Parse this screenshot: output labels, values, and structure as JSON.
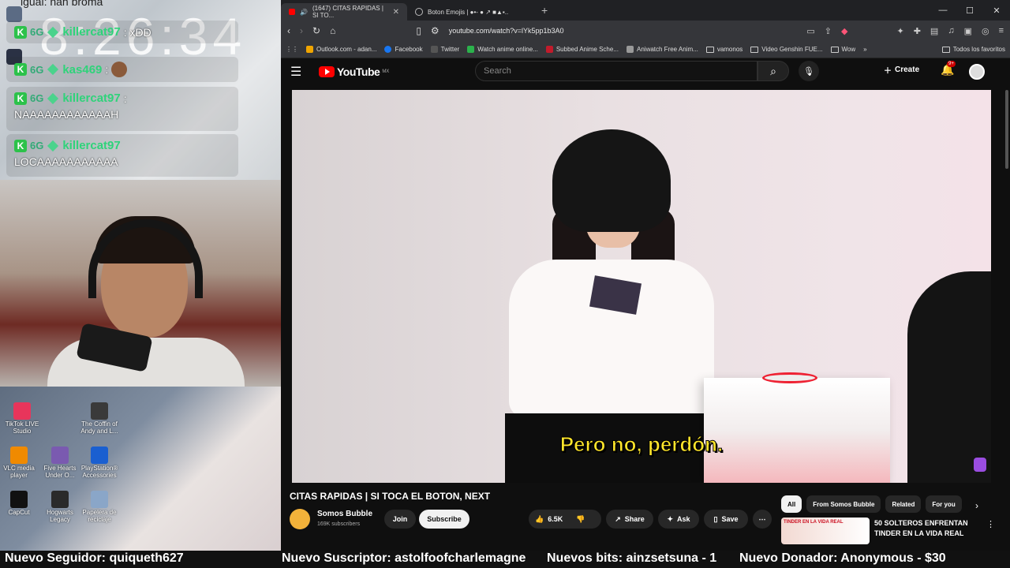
{
  "stream": {
    "clock": "8:26:34",
    "chat_top": "igual: nah broma",
    "messages": [
      {
        "user": "killercat97",
        "text": ": xDD"
      },
      {
        "user": "kas469",
        "text": ":"
      },
      {
        "user": "killercat97",
        "text": "NAAAAAAAAAAAAH"
      },
      {
        "user": "killercat97",
        "text": "LOCAAAAAAAAAAA"
      }
    ]
  },
  "desktop": {
    "icons": [
      {
        "label": "TikTok LIVE Studio",
        "color": "#e8355b"
      },
      {
        "label": "The Coffin of Andy and L...",
        "color": "#3a3a3a"
      },
      {
        "label": "VLC media player",
        "color": "#f08a00"
      },
      {
        "label": "Five Hearts Under O...",
        "color": "#7a5ab0"
      },
      {
        "label": "PlayStation® Accessories",
        "color": "#1a5fd0"
      },
      {
        "label": "CapCut",
        "color": "#111111"
      },
      {
        "label": "Hogwarts Legacy",
        "color": "#2a2a2a"
      },
      {
        "label": "Papelera de reciclaje",
        "color": "#8aa6c8"
      }
    ]
  },
  "browser": {
    "tabs": [
      {
        "title": "(1647) CITAS RAPIDAS | SI TO..."
      },
      {
        "title": "Boton Emojis | ●•- ● ↗ ■▲▪.."
      }
    ],
    "url": "youtube.com/watch?v=lYk5pp1b3A0",
    "bookmarks": [
      {
        "label": "Outlook.com - adan...",
        "color": "#f0a500"
      },
      {
        "label": "Facebook",
        "color": "#1877f2"
      },
      {
        "label": "Twitter",
        "color": "#555555"
      },
      {
        "label": "Watch anime online...",
        "color": "#2bb24c"
      },
      {
        "label": "Subbed Anime Sche...",
        "color": "#c21b2b"
      },
      {
        "label": "Aniwatch Free Anim...",
        "color": "#999999"
      },
      {
        "label": "vamonos",
        "color": "folder"
      },
      {
        "label": "Video Genshin FUE...",
        "color": "folder"
      },
      {
        "label": "Wow",
        "color": "folder"
      }
    ],
    "all_bookmarks": "Todos los favoritos"
  },
  "youtube": {
    "logo": "YouTube",
    "region": "MX",
    "search_placeholder": "Search",
    "create": "Create",
    "notif_count": "9+",
    "subtitle": "Pero no, perdón.",
    "video_title": "CITAS RAPIDAS | SI TOCA EL BOTON, NEXT",
    "channel": "Somos Bubble",
    "subscribers": "169K subscribers",
    "join": "Join",
    "subscribe": "Subscribe",
    "likes": "6.5K",
    "share": "Share",
    "ask": "Ask",
    "save": "Save",
    "chips": [
      "All",
      "From Somos Bubble",
      "Related",
      "For you"
    ],
    "rec_thumb_text": "TINDER EN LA VIDA REAL",
    "rec_title": "50 SOLTEROS ENFRENTAN TINDER EN LA VIDA REAL"
  },
  "ticker": {
    "follower": "Nuevo Seguidor: quiqueth627",
    "subscriber": "Nuevo Suscriptor: astolfoofcharlemagne",
    "bits": "Nuevos bits: ainzsetsuna - 1",
    "donor": "Nuevo Donador: Anonymous - $30"
  }
}
